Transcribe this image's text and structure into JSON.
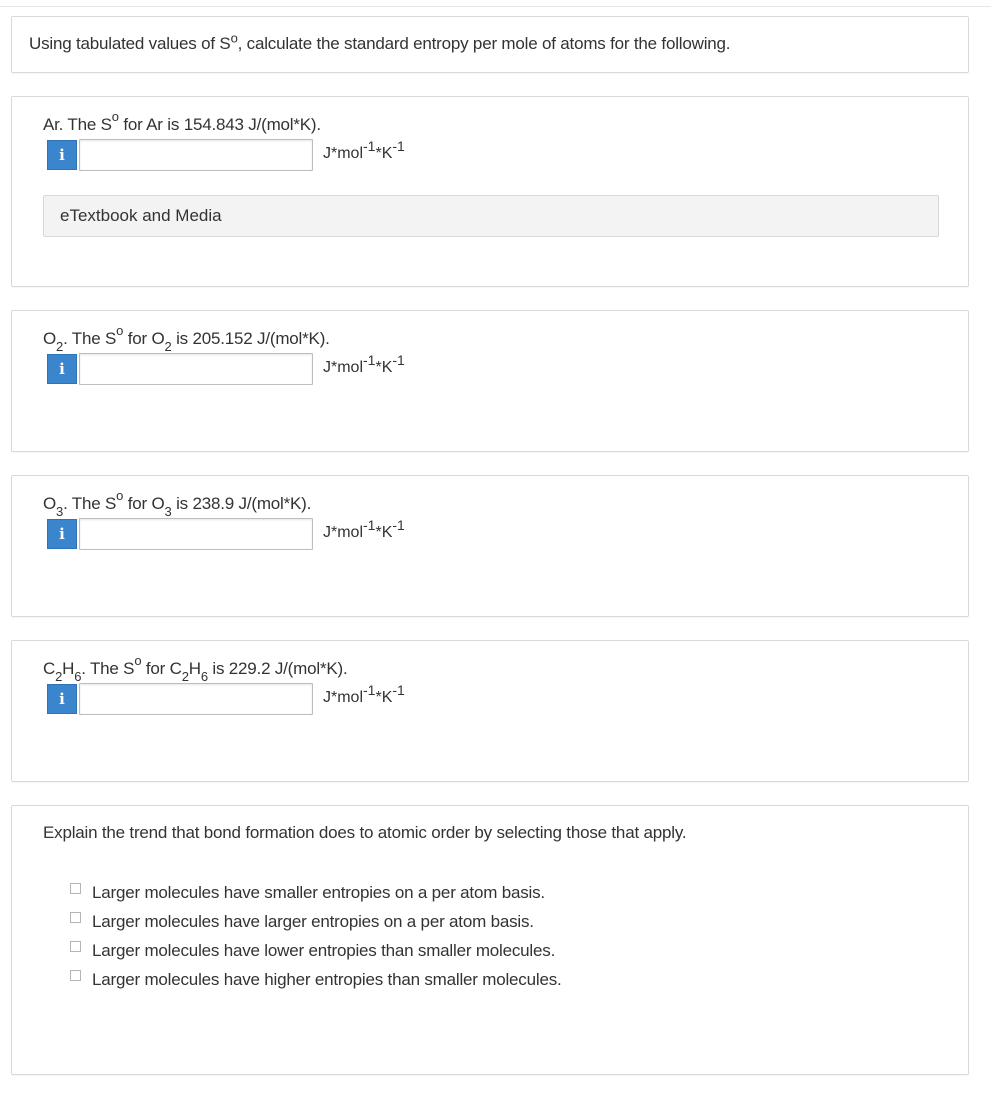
{
  "intro": {
    "pre": "Using tabulated values of S",
    "sup": "o",
    "post": ", calculate the standard entropy per mole of atoms for the following."
  },
  "questions": [
    {
      "prefix": "Ar",
      "prefix_sub": "",
      "prefix_tail": "",
      "middle": ". The S",
      "sup": "o",
      "for": " for ",
      "species": "Ar",
      "species_sub": "",
      "species_tail": "",
      "value_text": " is 154.843 J/(mol*K).",
      "input_value": "",
      "input_placeholder": ""
    },
    {
      "prefix": "O",
      "prefix_sub": "2",
      "prefix_tail": "",
      "middle": ". The S",
      "sup": "o",
      "for": " for ",
      "species": "O",
      "species_sub": "2",
      "species_tail": "",
      "value_text": " is 205.152 J/(mol*K).",
      "input_value": "",
      "input_placeholder": ""
    },
    {
      "prefix": "O",
      "prefix_sub": "3",
      "prefix_tail": "",
      "middle": ". The S",
      "sup": "o",
      "for": " for ",
      "species": "O",
      "species_sub": "3",
      "species_tail": "",
      "value_text": " is 238.9 J/(mol*K).",
      "input_value": "",
      "input_placeholder": ""
    },
    {
      "prefix": "C",
      "prefix_sub": "2",
      "prefix_tail": "H",
      "prefix_sub2": "6",
      "middle": ". The S",
      "sup": "o",
      "for": " for ",
      "species": "C",
      "species_sub": "2",
      "species_tail": "H",
      "species_sub2": "6",
      "value_text": " is 229.2 J/(mol*K).",
      "input_value": "",
      "input_placeholder": ""
    }
  ],
  "unit": {
    "base": "J*mol",
    "exp1": "-1",
    "mid": "*K",
    "exp2": "-1"
  },
  "info_icon_glyph": "i",
  "etextbook_label": "eTextbook and Media",
  "trend": {
    "prompt": "Explain the trend that bond formation does to atomic order by selecting those that apply.",
    "options": [
      {
        "label": "Larger molecules have smaller entropies on a per atom basis.",
        "checked": false
      },
      {
        "label": "Larger molecules have larger entropies on a per atom basis.",
        "checked": false
      },
      {
        "label": "Larger molecules have lower entropies than smaller molecules.",
        "checked": false
      },
      {
        "label": "Larger molecules have higher entropies than smaller molecules.",
        "checked": false
      }
    ]
  },
  "colors": {
    "info_button": "#3a85cc",
    "panel_border": "#d9d9d9",
    "etextbook_bg": "#f3f3f3"
  }
}
